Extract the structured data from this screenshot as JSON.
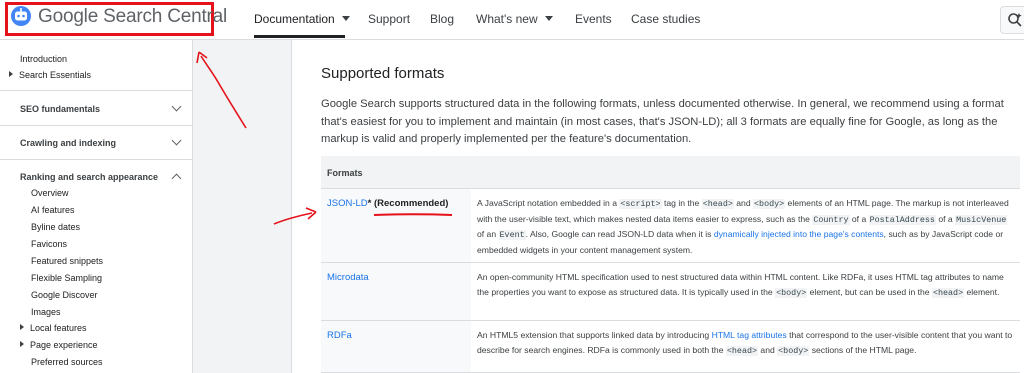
{
  "header": {
    "logo_text": "Google Search Central",
    "nav": [
      {
        "label": "Documentation",
        "has_caret": true
      },
      {
        "label": "Support"
      },
      {
        "label": "Blog"
      },
      {
        "label": "What's new",
        "has_caret": true
      },
      {
        "label": "Events"
      },
      {
        "label": "Case studies"
      }
    ]
  },
  "sidebar": {
    "top_items": [
      "Introduction",
      "Search Essentials"
    ],
    "sections": [
      "SEO fundamentals",
      "Crawling and indexing",
      "Ranking and search appearance"
    ],
    "sub_items": [
      "Overview",
      "AI features",
      "Byline dates",
      "Favicons",
      "Featured snippets",
      "Flexible Sampling",
      "Google Discover",
      "Images",
      "Local features",
      "Page experience",
      "Preferred sources"
    ]
  },
  "content": {
    "heading": "Supported formats",
    "intro": "Google Search supports structured data in the following formats, unless documented otherwise. In general, we recommend using a format that's easiest for you to implement and maintain (in most cases, that's JSON-LD); all 3 formats are equally fine for Google, as long as the markup is valid and properly implemented per the feature's documentation.",
    "table": {
      "header": "Formats",
      "rows": [
        {
          "format": "JSON-LD",
          "asterisk": "*",
          "recommended": "(Recommended)",
          "d": [
            "A JavaScript notation embedded in a ",
            "<script>",
            " tag in the ",
            "<head>",
            " and ",
            "<body>",
            " elements of an HTML page. The markup is not interleaved with the user-visible text, which makes nested data items easier to express, such as the ",
            "Country",
            " of a ",
            "PostalAddress",
            " of a ",
            "MusicVenue",
            " of an ",
            "Event",
            ". Also, Google can read JSON-LD data when it is ",
            "dynamically injected into the page's contents",
            ", such as by JavaScript code or embedded widgets in your content management system."
          ]
        },
        {
          "format": "Microdata",
          "d": [
            "An open-community HTML specification used to nest structured data within HTML content. Like RDFa, it uses HTML tag attributes to name the properties you want to expose as structured data. It is typically used in the ",
            "<body>",
            " element, but can be used in the ",
            "<head>",
            " element."
          ]
        },
        {
          "format": "RDFa",
          "d": [
            "An HTML5 extension that supports linked data by introducing ",
            "HTML tag attributes",
            " that correspond to the user-visible content that you want to describe for search engines. RDFa is commonly used in both the ",
            "<head>",
            " and ",
            "<body>",
            " sections of the HTML page."
          ]
        }
      ]
    }
  },
  "colors": {
    "annotation": "#e5121b",
    "link": "#1a73e8"
  }
}
